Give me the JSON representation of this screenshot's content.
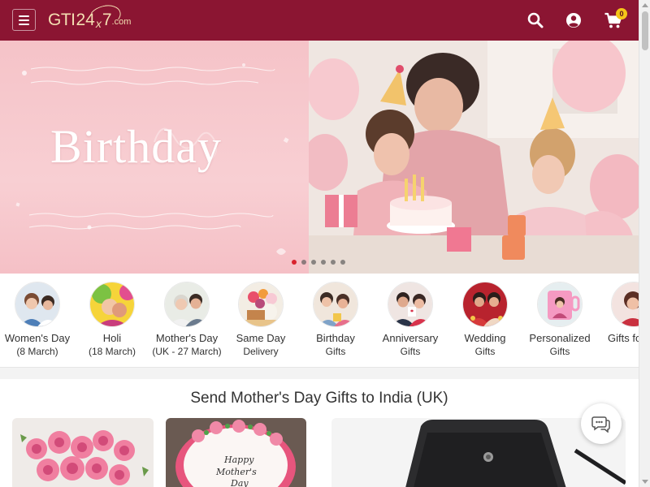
{
  "header": {
    "logo": {
      "main": "GTI",
      "num": "24",
      "x": "x",
      "seven": "7",
      "domain": ".com"
    },
    "colors": {
      "background": "#8b1532",
      "logo": "#f4dfb2",
      "badge": "#f5c518"
    },
    "icons": [
      "menu-icon",
      "search-icon",
      "user-icon",
      "cart-icon"
    ],
    "cart_count": "0"
  },
  "banner": {
    "title": "Birthday",
    "slide_count": 6,
    "active_slide": 1
  },
  "categories": [
    {
      "line1": "Women's Day",
      "line2": "(8 March)"
    },
    {
      "line1": "Holi",
      "line2": "(18 March)"
    },
    {
      "line1": "Mother's Day",
      "line2": "(UK - 27 March)"
    },
    {
      "line1": "Same Day",
      "line2": "Delivery"
    },
    {
      "line1": "Birthday",
      "line2": "Gifts"
    },
    {
      "line1": "Anniversary",
      "line2": "Gifts"
    },
    {
      "line1": "Wedding",
      "line2": "Gifts"
    },
    {
      "line1": "Personalized",
      "line2": "Gifts"
    },
    {
      "line1": "Gifts fo",
      "line2": ""
    }
  ],
  "main": {
    "section_title": "Send Mother's Day Gifts to India (UK)",
    "products": [
      {
        "icon": "roses-image"
      },
      {
        "icon": "cake-image"
      },
      {
        "icon": "handbag-image"
      }
    ]
  },
  "chat": {
    "icon": "chat-icon"
  }
}
